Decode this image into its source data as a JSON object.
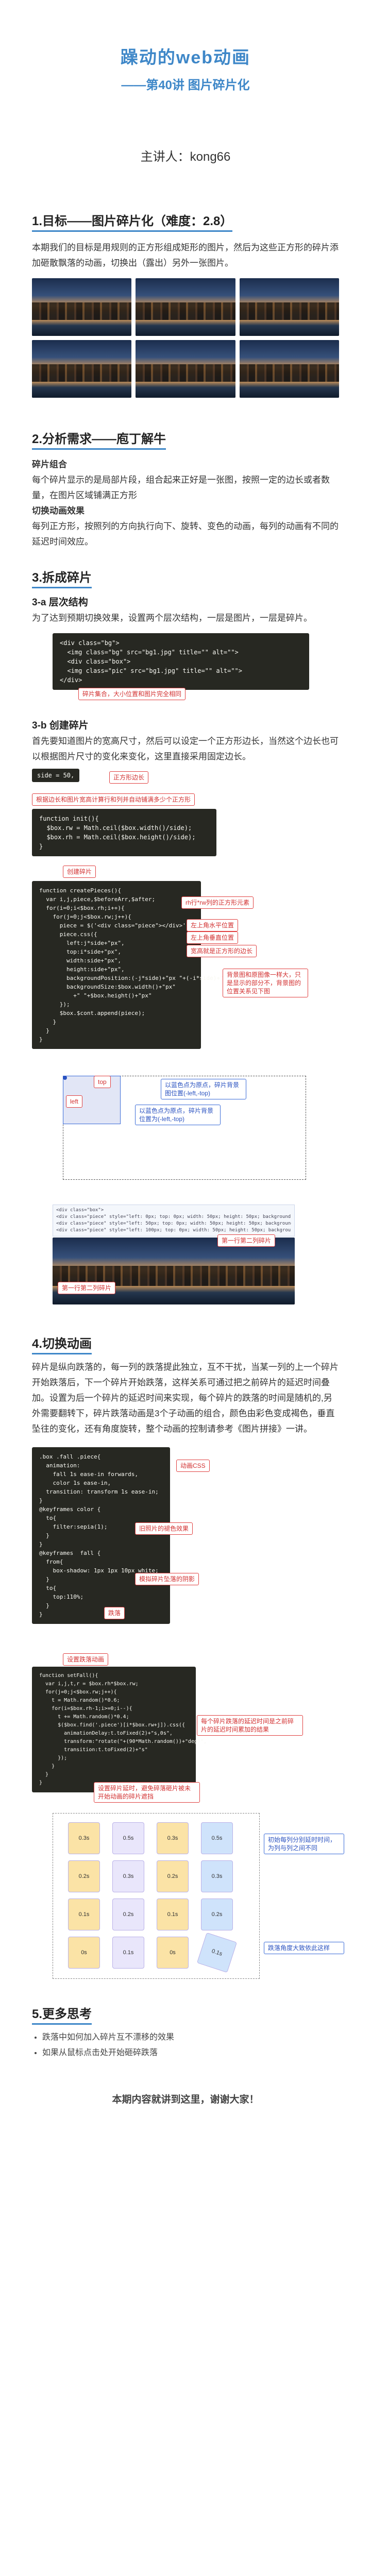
{
  "hero": {
    "title": "躁动的web动画",
    "subtitle": "——第40讲 图片碎片化",
    "speaker": "主讲人：kong66"
  },
  "s1": {
    "title": "1.目标——图片碎片化（难度：2.8）",
    "body": "本期我们的目标是用规则的正方形组成矩形的图片，然后为这些正方形的碎片添加砸散飘落的动画，切换出（露出）另外一张图片。"
  },
  "s2": {
    "title": "2.分析需求——庖丁解牛",
    "h_pieces": "碎片组合",
    "pieces_body": "每个碎片显示的是局部片段，组合起来正好是一张图，按照一定的边长或者数量，在图片区域铺满正方形",
    "h_anim": "切换动画效果",
    "anim_body": "每列正方形，按照列的方向执行向下、旋转、变色的动画，每列的动画有不同的延迟时间效应。"
  },
  "s3": {
    "title": "3.拆成碎片",
    "a_title": "3-a 层次结构",
    "a_body": "为了达到预期切换效果，设置两个层次结构，一层是图片，一层是碎片。",
    "code_a": [
      {
        "p": "<div class=\"bg\">"
      },
      {
        "p": "  <img class=\"bg\" src=\"bg1.jpg\" title=\"\" alt=\"\">"
      },
      {
        "p": "  <div class=\"box\">"
      },
      {
        "p": "  <img class=\"pic\" src=\"bg1.jpg\" title=\"\" alt=\"\">"
      },
      {
        "p": "</div>"
      }
    ],
    "code_a_callout": "碎片集合，大小位置和图片完全相同",
    "b_title": "3-b 创建碎片",
    "b_body": "首先要知道图片的宽高尺寸，然后可以设定一个正方形边长，当然这个边长也可以根据图片尺寸的变化来变化，这里直接采用固定边长。",
    "side_code": "side = 50,",
    "side_callout": "正方形边长",
    "calc_callout": "根据边长和图片宽高计算行和列并自动铺满多少个正方形",
    "code_b": [
      "function init(){",
      "  $box.rw = Math.ceil($box.width()/side);",
      "  $box.rh = Math.ceil($box.height()/side);",
      "}"
    ],
    "create_callout": "创建碎片",
    "code_c": [
      "function createPieces(){",
      "  var i,j,piece,$beforeArr,$after;",
      "  for(i=0;i<$box.rh;i++){",
      "    for(j=0;j<$box.rw;j++){",
      "      piece = $('<div class=\"piece\"></div>');",
      "      piece.css({",
      "        left:j*side+\"px\",",
      "        top:i*side+\"px\",",
      "        width:side+\"px\",",
      "        height:side+\"px\",",
      "        backgroundPosition:(-j*side)+\"px \"+(-i*side)+\"px\",",
      "        backgroundSize:$box.width()+\"px\"",
      "          +\" \"+$box.height()+\"px\"",
      "      });",
      "      $box.$cont.append(piece);",
      "    }",
      "  }",
      "}"
    ],
    "cb1": "rh行*rw列的正方形元素",
    "cb2": "左上角水平位置",
    "cb3": "左上角垂直位置",
    "cb4": "宽高就是正方形的边长",
    "cb5": "背景图和原图像一样大，只是显示的部分不，背景图的位置关系见下图",
    "top_lbl": "top",
    "left_lbl": "left",
    "diag1": "以蓝色点为原点，碎片背景图位置(-left,-top)",
    "diag2": "以蓝色点为原点，碎片背景位置为(-left,-top)",
    "dev_lines": [
      "<div class=\"box\">",
      "  <div class=\"piece\" style=\"left: 0px; top: 0px; width: 50px; height: 50px; background-position: 0px 0px; background-size: 720px 396px;\"></div>",
      "  <div class=\"piece\" style=\"left: 50px; top: 0px; width: 50px; height: 50px; background-position: -50px 0px; background-size: 720px 396px;\"></div>",
      "  <div class=\"piece\" style=\"left: 100px; top: 0px; width: 50px; height: 50px; background-position: -100px 0px; background-size: 720px 396px;\"></div>"
    ],
    "row1_callout": "第一行第二列碎片",
    "row1b_callout": "第一行第二列碎片"
  },
  "s4": {
    "title": "4.切换动画",
    "body": "碎片是纵向跌落的，每一列的跌落提此独立，互不干扰，当某一列的上一个碎片开始跌落后，下一个碎片开始跌落，这样关系可通过把之前碎片的延迟时间叠加。设置为后一个碎片的延迟时间来实现，每个碎片的跌落的时间是随机的,另外需要翻转下，碎片跌落动画是3个子动画的组合，颜色由彩色变成褐色，垂直坠往的变化，还有角度旋转，整个动画的控制请参考《图片拼接》一讲。",
    "code_d": [
      ".box .fall .piece{",
      "  animation:",
      "    fall 1s ease-in forwards,",
      "    color 1s ease-in,",
      "  transition: transform 1s ease-in;",
      "}",
      "",
      "@keyframes color {",
      "  to{",
      "    filter:sepia(1);",
      "  }",
      "}",
      "",
      "@keyframes  fall {",
      "  from{",
      "    box-shadow: 1px 1px 10px white;",
      "  }",
      "  to{",
      "    top:110%;",
      "  }",
      "}"
    ],
    "c_anim": "动画CSS",
    "c_old": "旧照片的褪色效果",
    "c_fall": "模拟碎片坠落的阴影",
    "c_drop": "跌落",
    "delay_callout": "设置跌落动画",
    "code_e": [
      "function setFall(){",
      "  var i,j,t,r = $box.rh*$box.rw;",
      "  for(j=0;j<$box.rw;j++){",
      "    t = Math.random()*0.6;",
      "    for(i=$box.rh-1;i>=0;i--){",
      "      t += Math.random()*0.4;",
      "      $($box.find('.piece')[i*$box.rw+j]).css({",
      "        animationDelay:t.toFixed(2)+\"s,0s\",",
      "        transform:\"rotate(\"+(90*Math.random())+\"deg)\",",
      "        transition:t.toFixed(2)+\"s\"",
      "      });",
      "    }",
      "  }",
      "}"
    ],
    "c_delay": "每个碎片跌落的延迟时间是之前碎片的延迟时间累加的结果",
    "c_row": "设置碎片延时，避免碎落砸片被未开始动画的碎片遮挡",
    "tiles": [
      [
        "0.3s",
        "0.5s",
        "0.3s",
        "0.5s"
      ],
      [
        "0.2s",
        "0.3s",
        "0.2s",
        "0.3s"
      ],
      [
        "0.1s",
        "0.2s",
        "0.1s",
        "0.2s"
      ],
      [
        "0s",
        "0.1s",
        "0s",
        "0.1s"
      ]
    ],
    "tile_c1": "初始每列分别延时时间，为列与列之间不同",
    "tile_c2": "跌落角度大致依此这样"
  },
  "s5": {
    "title": "5.更多思考",
    "items": [
      "跌落中如何加入碎片互不漂移的效果",
      "如果从鼠标点击处开始砸碎跌落"
    ],
    "end": "本期内容就讲到这里，谢谢大家！"
  },
  "colors": {
    "accent": "#3e87c8",
    "callout": "#e04040"
  }
}
